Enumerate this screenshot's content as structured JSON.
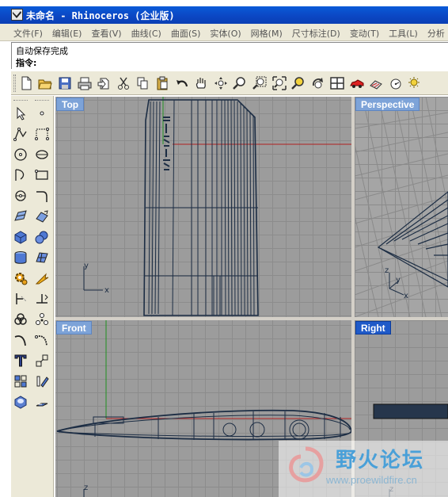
{
  "window": {
    "title": "未命名 - Rhinoceros (企业版)"
  },
  "menubar": {
    "items": [
      "文件(F)",
      "编辑(E)",
      "查看(V)",
      "曲线(C)",
      "曲面(S)",
      "实体(O)",
      "网格(M)",
      "尺寸标注(D)",
      "变动(T)",
      "工具(L)",
      "分析"
    ]
  },
  "command_area": {
    "history_line": "自动保存完成",
    "prompt": "指令:"
  },
  "toolbar": {
    "icons": [
      "new-file-icon",
      "open-folder-icon",
      "save-icon",
      "print-icon",
      "import-icon",
      "cut-icon",
      "copy-icon",
      "paste-icon",
      "undo-icon",
      "pan-hand-icon",
      "rotate-view-icon",
      "zoom-icon",
      "zoom-window-icon",
      "zoom-extents-icon",
      "zoom-selected-icon",
      "rotate-view-icon",
      "four-viewports-icon",
      "car-icon",
      "render-icon",
      "analyze-icon",
      "light-icon"
    ]
  },
  "left_toolbar": {
    "icons": [
      "select-arrow-icon",
      "point-icon",
      "polyline-icon",
      "curve-icon",
      "circle-icon",
      "ellipse-icon",
      "arc-icon",
      "rectangle-icon",
      "polygon-icon",
      "fillet-curve-icon",
      "surface-icon",
      "surface-edit-icon",
      "box-solid-icon",
      "sphere-solid-icon",
      "cylinder-icon",
      "mesh-plane-icon",
      "settings-gear-icon",
      "explode-icon",
      "trim-icon",
      "split-icon",
      "group-icon",
      "object-snap-icon",
      "fillet-icon",
      "blend-curve-icon",
      "text-icon",
      "transform-icon",
      "block-icon",
      "dimension-icon",
      "render-solid-icon",
      "layer-icon"
    ]
  },
  "viewports": {
    "top": {
      "label": "Top",
      "axis_y": "y",
      "axis_x": "x"
    },
    "perspective": {
      "label": "Perspective",
      "axis_z": "z",
      "axis_y": "y",
      "axis_x": "x"
    },
    "front": {
      "label": "Front",
      "axis_z": "z"
    },
    "right": {
      "label": "Right",
      "axis_z": "z"
    },
    "active": "right"
  },
  "watermark": {
    "name": "野火论坛",
    "url": "www.proewildfire.cn"
  },
  "colors": {
    "titlebar": "#0b47c4",
    "viewport_bg": "#9c9c9c",
    "wireframe": "#1c2d44",
    "axis_x": "#b02020",
    "axis_y": "#1f8f1f",
    "label_active": "#1f5ac8",
    "label_inactive": "#7da3d8"
  }
}
